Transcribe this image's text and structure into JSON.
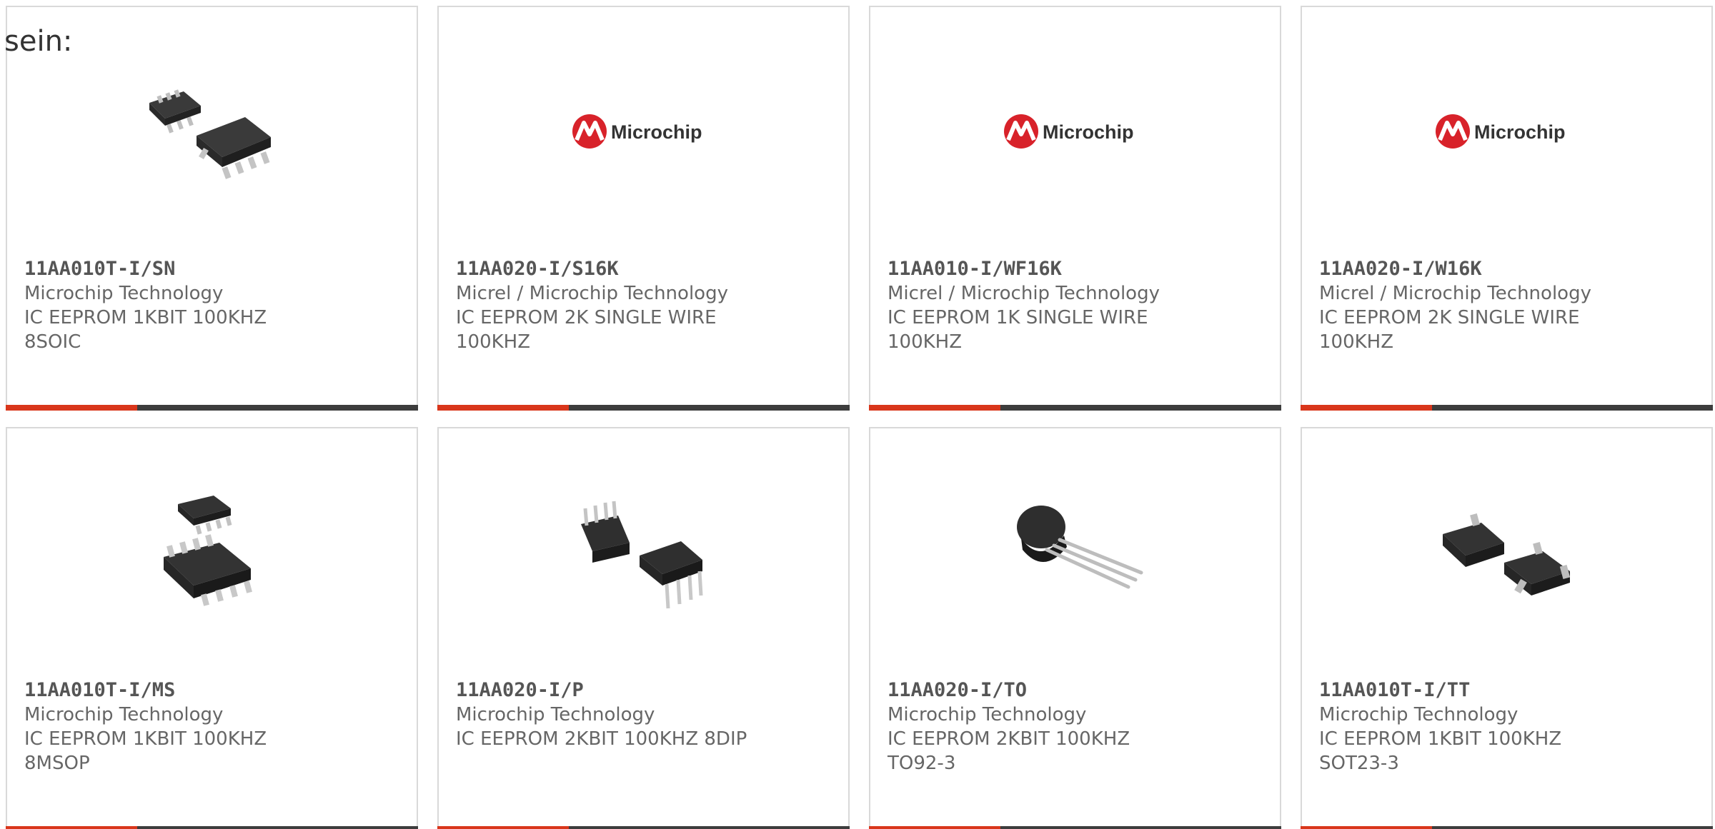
{
  "top_text": "sein:",
  "colors": {
    "accent": "#d9361b",
    "bar": "#3d3d3d",
    "border": "#d9d9d9",
    "microchip_red": "#d8222a"
  },
  "logo_text": "Microchip",
  "cards": [
    {
      "part_number": "11AA010T-I/SN",
      "manufacturer": "Microchip Technology",
      "description": "IC EEPROM 1KBIT 100KHZ 8SOIC",
      "image": "soic-8-chip-icon"
    },
    {
      "part_number": "11AA020-I/S16K",
      "manufacturer": "Micrel / Microchip Technology",
      "description": "IC EEPROM 2K SINGLE WIRE 100KHZ",
      "image": "microchip-logo"
    },
    {
      "part_number": "11AA010-I/WF16K",
      "manufacturer": "Micrel / Microchip Technology",
      "description": "IC EEPROM 1K SINGLE WIRE 100KHZ",
      "image": "microchip-logo"
    },
    {
      "part_number": "11AA020-I/W16K",
      "manufacturer": "Micrel / Microchip Technology",
      "description": "IC EEPROM 2K SINGLE WIRE 100KHZ",
      "image": "microchip-logo"
    },
    {
      "part_number": "11AA010T-I/MS",
      "manufacturer": "Microchip Technology",
      "description": "IC EEPROM 1KBIT 100KHZ 8MSOP",
      "image": "msop-8-chip-icon"
    },
    {
      "part_number": "11AA020-I/P",
      "manufacturer": "Microchip Technology",
      "description": "IC EEPROM 2KBIT 100KHZ 8DIP",
      "image": "dip-8-chip-icon"
    },
    {
      "part_number": "11AA020-I/TO",
      "manufacturer": "Microchip Technology",
      "description": "IC EEPROM 2KBIT 100KHZ TO92-3",
      "image": "to92-transistor-icon"
    },
    {
      "part_number": "11AA010T-I/TT",
      "manufacturer": "Microchip Technology",
      "description": "IC EEPROM 1KBIT 100KHZ SOT23-3",
      "image": "sot23-chip-icon"
    }
  ]
}
